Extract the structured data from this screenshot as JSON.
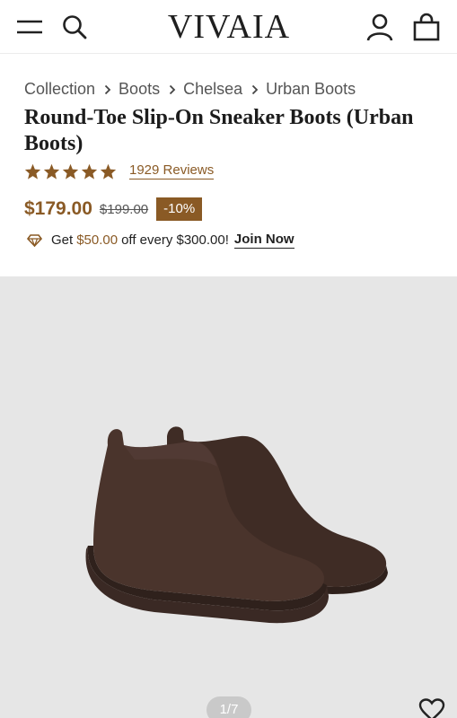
{
  "header": {
    "logo": "VIVAIA",
    "menu_icon": "hamburger-menu-icon",
    "search_icon": "search-icon",
    "account_icon": "account-icon",
    "bag_icon": "shopping-bag-icon"
  },
  "breadcrumb": [
    "Collection",
    "Boots",
    "Chelsea",
    "Urban Boots"
  ],
  "product": {
    "title": "Round-Toe Slip-On Sneaker Boots (Urban Boots)",
    "rating": 5,
    "reviews": "1929 Reviews",
    "price": "$179.00",
    "old_price": "$199.00",
    "discount": "-10%"
  },
  "promo": {
    "text_before": "Get",
    "amount": "$50.00",
    "text_after": "off every $300.00!",
    "link": "Join Now"
  },
  "gallery": {
    "counter": "1/7",
    "wishlist_icon": "heart-icon"
  },
  "colors": {
    "accent": "#8a5a25",
    "gallery_bg": "#e6e6e6",
    "boot": "#4a342c"
  }
}
